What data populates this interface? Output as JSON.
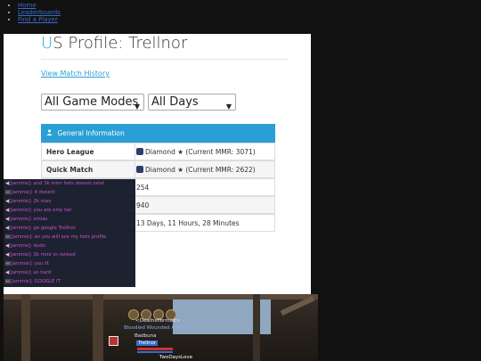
{
  "topnav": {
    "items": [
      "Home",
      "Leaderboards",
      "Find a Player"
    ]
  },
  "profile": {
    "title_first": "U",
    "title_rest": "S Profile: Trellnor",
    "history_link": "View Match History",
    "select_mode": "All Game Modes",
    "select_days": "All Days"
  },
  "general": {
    "header": "General Information",
    "rows": [
      {
        "label": "Hero League",
        "value": "Diamond ★ (Current MMR: 3071)"
      },
      {
        "label": "Quick Match",
        "value": "Diamond ★ (Current MMR: 2622)"
      },
      {
        "label": "",
        "value": "254"
      },
      {
        "label": "",
        "value": "940"
      },
      {
        "label": "",
        "value": "13 Days, 11 Hours, 28 Minutes"
      }
    ]
  },
  "chat": {
    "lines": [
      {
        "icon": "◀",
        "name": "[Jammie]",
        "text": ": and 3k mmr hots doesnt exist"
      },
      {
        "icon": "▤",
        "name": "[Jammie]",
        "text": ": it doesnt"
      },
      {
        "icon": "◀",
        "name": "[Jammie]",
        "text": ": 2k max"
      },
      {
        "icon": "◀",
        "name": "[Jammie]",
        "text": ": you are only liar"
      },
      {
        "icon": "◀",
        "name": "[Jammie]",
        "text": ": xmlas"
      },
      {
        "icon": "◀",
        "name": "[Jammie]",
        "text": ": go google Trellnor"
      },
      {
        "icon": "▤",
        "name": "[Jammie]",
        "text": ": an you will see my hots profile"
      },
      {
        "icon": "◀",
        "name": "[Jammie]",
        "text": ": dude"
      },
      {
        "icon": "◀",
        "name": "[Jammie]",
        "text": ": 3k mmr in ranked"
      },
      {
        "icon": "▤",
        "name": "[Jammie]",
        "text": ": you lit"
      },
      {
        "icon": "◀",
        "name": "[Jammie]",
        "text": ": so hard"
      },
      {
        "icon": "▤",
        "name": "[Jammie]",
        "text": ": GOOGLE IT"
      }
    ]
  },
  "game": {
    "plate1": "<Deathsflbrmad>",
    "plate2": "Bloodied Wounded Around",
    "plate3": "Badbuna",
    "plate4": "Trellnor",
    "plate5": "TwoDaysLove"
  },
  "colors": {
    "accent": "#2a9fd6",
    "chat_name": "#d04fd0",
    "header_bg": "#2a9fd6"
  }
}
